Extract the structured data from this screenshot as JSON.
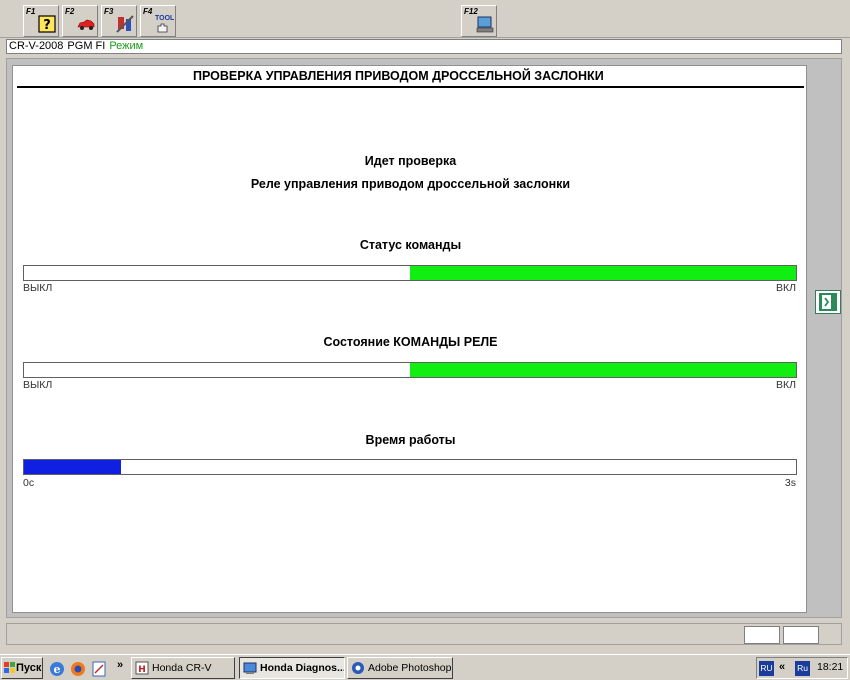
{
  "toolbar": {
    "keys": [
      {
        "label": "F1",
        "icon": "help-icon"
      },
      {
        "label": "F2",
        "icon": "car-icon"
      },
      {
        "label": "F3",
        "icon": "tools-icon"
      },
      {
        "label": "F4",
        "icon": "tool-hand-icon",
        "text": "TOOL"
      },
      {
        "label": "F12",
        "icon": "computer-icon"
      }
    ]
  },
  "vehicle": {
    "model": "CR-V-2008",
    "system": "PGM FI",
    "mode": "Режим"
  },
  "panel": {
    "title": "ПРОВЕРКА УПРАВЛЕНИЯ ПРИВОДОМ ДРОССЕЛЬНОЙ ЗАСЛОНКИ",
    "checking": "Идет проверка",
    "relay_name": "Реле управления приводом дроссельной заслонки"
  },
  "command_status": {
    "title": "Статус команды",
    "min_label": "ВЫКЛ",
    "max_label": "ВКЛ",
    "fill_start": 0.5,
    "fill_end": 1.0,
    "color": "#11ee11"
  },
  "relay_state": {
    "title": "Состояние КОМАНДЫ РЕЛЕ",
    "min_label": "ВЫКЛ",
    "max_label": "ВКЛ",
    "fill_start": 0.5,
    "fill_end": 1.0,
    "color": "#11ee11"
  },
  "run_time": {
    "title": "Время работы",
    "min_label": "0с",
    "max_label": "3s",
    "fill_start": 0.0,
    "fill_end": 0.125,
    "color": "#1020e0"
  },
  "taskbar": {
    "start_label": "Пуск",
    "overflow": "»",
    "tasks": [
      {
        "label": "Honda CR-V",
        "active": false
      },
      {
        "label": "Honda Diagnos...",
        "active": true
      },
      {
        "label": "Adobe Photoshop",
        "active": false
      }
    ],
    "tray": {
      "lang1": "RU",
      "chevron": "«",
      "lang2": "Ru",
      "time": "18:21"
    }
  }
}
